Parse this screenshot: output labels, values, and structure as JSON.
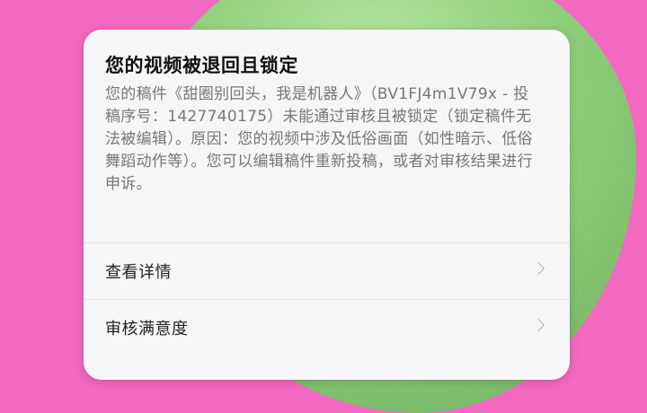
{
  "dialog": {
    "title": "您的视频被退回且锁定",
    "message": "您的稿件《甜圈别回头，我是机器人》（BV1FJ4m1V79x - 投稿序号：1427740175）未能通过审核且被锁定（锁定稿件无法被编辑）。原因：您的视频中涉及低俗画面（如性暗示、低俗舞蹈动作等）。您可以编辑稿件重新投稿，或者对审核结果进行申诉。"
  },
  "actions": [
    {
      "label": "查看详情",
      "icon": "chevron-right-icon"
    },
    {
      "label": "审核满意度",
      "icon": "chevron-right-icon"
    }
  ],
  "colors": {
    "background": "#f368c0",
    "card": "#f6f6f8"
  }
}
